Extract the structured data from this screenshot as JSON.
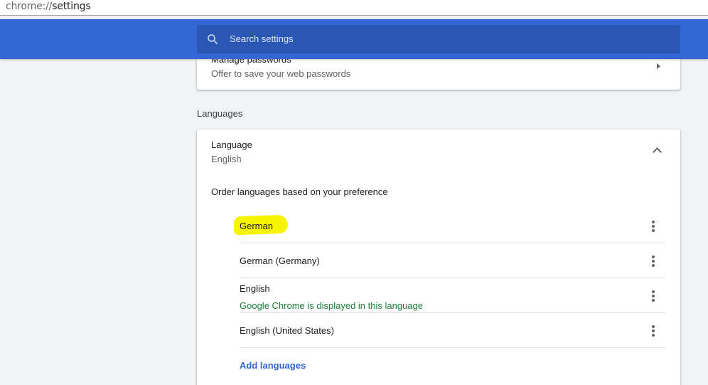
{
  "address_bar": {
    "scheme": "chrome://",
    "host": "settings"
  },
  "search": {
    "placeholder": "Search settings",
    "icon": "search-icon"
  },
  "passwords": {
    "title": "Manage passwords",
    "subtitle": "Offer to save your web passwords"
  },
  "languages_section": {
    "title": "Languages",
    "language_label": "Language",
    "language_value": "English",
    "order_text": "Order languages based on your preference",
    "items": [
      {
        "label": "German",
        "note": "",
        "highlighted": true
      },
      {
        "label": "German (Germany)",
        "note": ""
      },
      {
        "label": "English",
        "note": "Google Chrome is displayed in this language"
      },
      {
        "label": "English (United States)",
        "note": ""
      }
    ],
    "add_label": "Add languages"
  },
  "colors": {
    "toolbar": "#3367d6",
    "search_bg": "#2a56b4",
    "link": "#3367d6",
    "note": "#188038",
    "highlight": "#f7f400"
  }
}
